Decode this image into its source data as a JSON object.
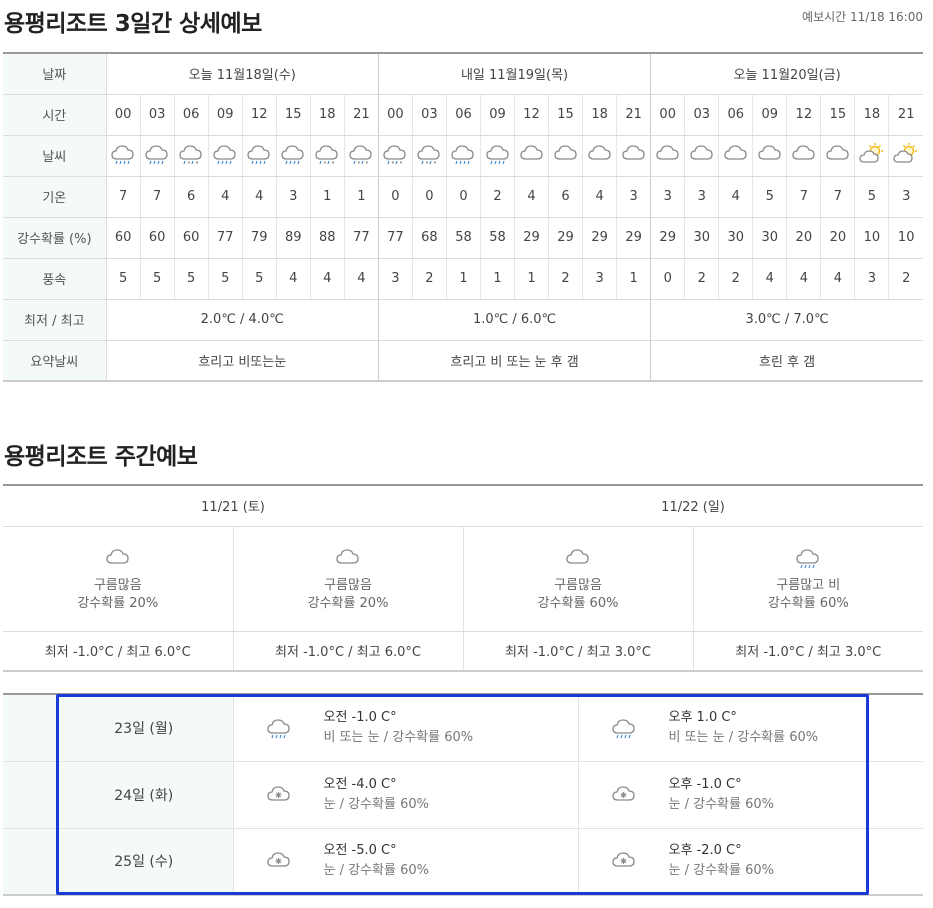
{
  "header": {
    "title": "용평리조트 3일간 상세예보",
    "forecast_time": "예보시간 11/18 16:00"
  },
  "three_day": {
    "labels": {
      "date": "날짜",
      "time": "시간",
      "weather": "날씨",
      "temp": "기온",
      "precip": "강수확률 (%)",
      "wind": "풍속",
      "minmax": "최저 / 최고",
      "summary": "요약날씨"
    },
    "days": [
      {
        "label": "오늘 11월18일(수)",
        "minmax": "2.0℃ / 4.0℃",
        "summary": "흐리고 비또는눈"
      },
      {
        "label": "내일 11월19일(목)",
        "minmax": "1.0℃ / 6.0℃",
        "summary": "흐리고 비 또는 눈 후 갬"
      },
      {
        "label": "오늘 11월20일(금)",
        "minmax": "3.0℃ / 7.0℃",
        "summary": "흐린 후 갬"
      }
    ],
    "times": [
      "00",
      "03",
      "06",
      "09",
      "12",
      "15",
      "18",
      "21",
      "00",
      "03",
      "06",
      "09",
      "12",
      "15",
      "18",
      "21",
      "00",
      "03",
      "06",
      "09",
      "12",
      "15",
      "18",
      "21"
    ],
    "icons": [
      "rain-cloud-icon",
      "rain-cloud-icon",
      "sleet-cloud-icon",
      "rain-cloud-icon",
      "rain-cloud-icon",
      "rain-cloud-icon",
      "sleet-cloud-icon",
      "sleet-cloud-icon",
      "sleet-cloud-icon",
      "sleet-cloud-icon",
      "rain-cloud-icon",
      "rain-cloud-icon",
      "cloud-icon",
      "cloud-icon",
      "cloud-icon",
      "cloud-icon",
      "cloud-icon",
      "cloud-icon",
      "cloud-icon",
      "cloud-icon",
      "cloud-icon",
      "cloud-icon",
      "sun-cloud-icon",
      "sun-cloud-icon"
    ],
    "temps": [
      "7",
      "7",
      "6",
      "4",
      "4",
      "3",
      "1",
      "1",
      "0",
      "0",
      "0",
      "2",
      "4",
      "6",
      "4",
      "3",
      "3",
      "3",
      "4",
      "5",
      "7",
      "7",
      "5",
      "3"
    ],
    "precip": [
      "60",
      "60",
      "60",
      "77",
      "79",
      "89",
      "88",
      "77",
      "77",
      "68",
      "58",
      "58",
      "29",
      "29",
      "29",
      "29",
      "29",
      "30",
      "30",
      "30",
      "20",
      "20",
      "10",
      "10"
    ],
    "wind": [
      "5",
      "5",
      "5",
      "5",
      "5",
      "4",
      "4",
      "4",
      "3",
      "2",
      "1",
      "1",
      "1",
      "2",
      "3",
      "1",
      "0",
      "2",
      "2",
      "4",
      "4",
      "4",
      "3",
      "2"
    ]
  },
  "weekly": {
    "title": "용평리조트 주간예보",
    "dates": [
      "11/21 (토)",
      "11/22 (일)"
    ],
    "cells": [
      {
        "icon": "cloud-icon",
        "desc": "구름많음",
        "precip": "강수확률 20%",
        "minmax": "최저 -1.0°C / 최고 6.0°C"
      },
      {
        "icon": "cloud-icon",
        "desc": "구름많음",
        "precip": "강수확률 20%",
        "minmax": "최저 -1.0°C / 최고 6.0°C"
      },
      {
        "icon": "cloud-icon",
        "desc": "구름많음",
        "precip": "강수확률 60%",
        "minmax": "최저 -1.0°C / 최고 3.0°C"
      },
      {
        "icon": "rain-cloud-icon",
        "desc": "구름많고 비",
        "precip": "강수확률 60%",
        "minmax": "최저 -1.0°C / 최고 3.0°C"
      }
    ],
    "later": [
      {
        "day": "23일 (월)",
        "am": {
          "icon": "rain-cloud-icon",
          "temp": "오전 -1.0 C°",
          "desc": "비 또는 눈 / 강수확률 60%"
        },
        "pm": {
          "icon": "rain-cloud-icon",
          "temp": "오후 1.0 C°",
          "desc": "비 또는 눈 / 강수확률 60%"
        }
      },
      {
        "day": "24일 (화)",
        "am": {
          "icon": "snow-cloud-icon",
          "temp": "오전 -4.0 C°",
          "desc": "눈 / 강수확률 60%"
        },
        "pm": {
          "icon": "snow-cloud-icon",
          "temp": "오후 -1.0 C°",
          "desc": "눈 / 강수확률 60%"
        }
      },
      {
        "day": "25일 (수)",
        "am": {
          "icon": "snow-cloud-icon",
          "temp": "오전 -5.0 C°",
          "desc": "눈 / 강수확률 60%"
        },
        "pm": {
          "icon": "snow-cloud-icon",
          "temp": "오후 -2.0 C°",
          "desc": "눈 / 강수확률 60%"
        }
      }
    ]
  },
  "colors": {
    "label_bg": "#f3faf9",
    "highlight_border": "#1a3ad8",
    "icon_stroke": "#8a8a8a",
    "rain": "#4a8fd6",
    "sun": "#f0b400"
  }
}
